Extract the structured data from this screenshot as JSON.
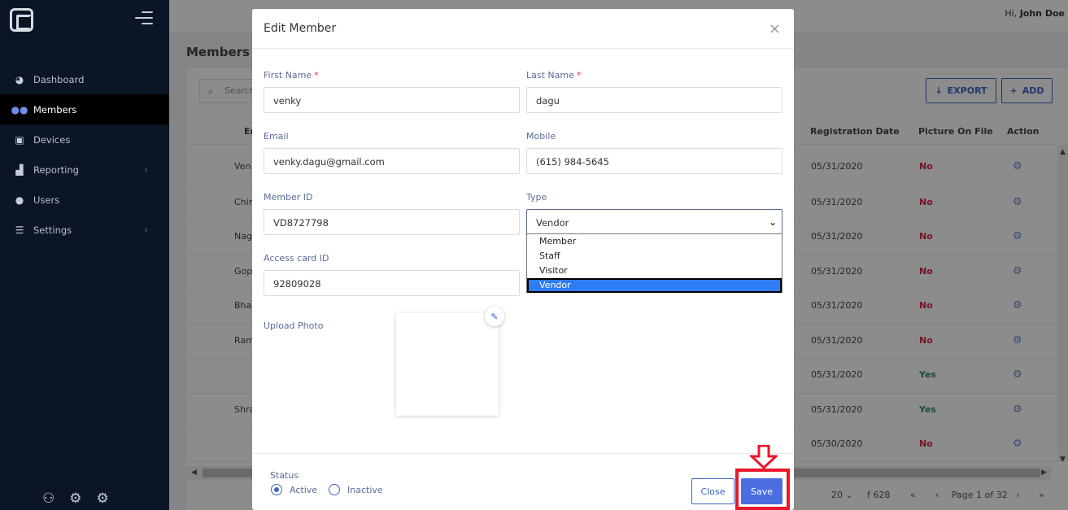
{
  "topbar": {
    "greeting_prefix": "Hi,",
    "user_name": "John Doe"
  },
  "sidebar": {
    "items": [
      {
        "label": "Dashboard",
        "icon": "dashboard-icon",
        "active": false
      },
      {
        "label": "Members",
        "icon": "members-icon",
        "active": true
      },
      {
        "label": "Devices",
        "icon": "device-icon",
        "active": false
      },
      {
        "label": "Reporting",
        "icon": "chart-icon",
        "active": false,
        "has_children": true
      },
      {
        "label": "Users",
        "icon": "user-icon",
        "active": false
      },
      {
        "label": "Settings",
        "icon": "sliders-icon",
        "active": false,
        "has_children": true
      }
    ]
  },
  "page": {
    "title": "Members",
    "search_placeholder": "Search",
    "export_label": "EXPORT",
    "add_label": "ADD",
    "columns": {
      "name": "Em",
      "registration_date": "Registration Date",
      "picture_on_file": "Picture On File",
      "action": "Action"
    },
    "rows": [
      {
        "name": "Ven",
        "date": "05/31/2020",
        "picture": "No"
      },
      {
        "name": "Chir",
        "date": "05/31/2020",
        "picture": "No"
      },
      {
        "name": "Nag",
        "date": "05/31/2020",
        "picture": "No"
      },
      {
        "name": "Gop",
        "date": "05/31/2020",
        "picture": "No"
      },
      {
        "name": "Bha",
        "date": "05/31/2020",
        "picture": "No"
      },
      {
        "name": "Ram",
        "date": "05/31/2020",
        "picture": "No"
      },
      {
        "name": "",
        "date": "05/31/2020",
        "picture": "Yes"
      },
      {
        "name": "Shra",
        "date": "05/31/2020",
        "picture": "Yes"
      },
      {
        "name": "",
        "date": "05/30/2020",
        "picture": "No"
      }
    ],
    "pager": {
      "page_size": "20",
      "total_suffix": "f 628",
      "page_text": "Page 1 of 32",
      "first": "«",
      "prev": "‹",
      "next": "›",
      "last": "»"
    }
  },
  "modal": {
    "title": "Edit Member",
    "close_icon": "×",
    "first_name": {
      "label": "First Name",
      "required": "*",
      "value": "venky"
    },
    "last_name": {
      "label": "Last Name",
      "required": "*",
      "value": "dagu"
    },
    "email": {
      "label": "Email",
      "value": "venky.dagu@gmail.com"
    },
    "mobile": {
      "label": "Mobile",
      "value": "(615) 984-5645"
    },
    "member_id": {
      "label": "Member ID",
      "value": "VD8727798"
    },
    "type": {
      "label": "Type",
      "value": "Vendor",
      "options": [
        "Member",
        "Staff",
        "Visitor",
        "Vendor"
      ],
      "selected": "Vendor"
    },
    "access_card": {
      "label": "Access card ID",
      "value": "92809028"
    },
    "upload_photo": {
      "label": "Upload Photo"
    },
    "status": {
      "label": "Status",
      "active_label": "Active",
      "inactive_label": "Inactive",
      "selected": "Active"
    },
    "close_button": "Close",
    "save_button": "Save"
  },
  "annotation": {
    "highlight_color": "#e8182b"
  }
}
